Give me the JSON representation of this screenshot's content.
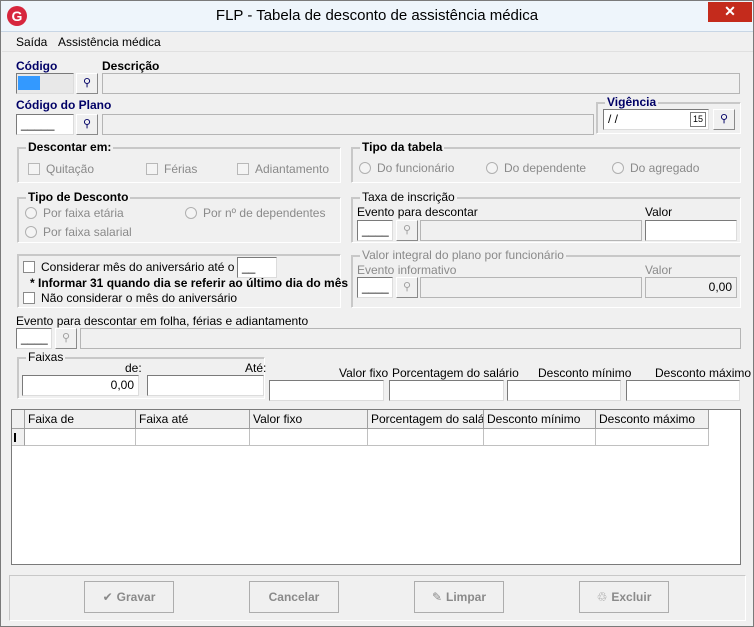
{
  "window": {
    "title": "FLP - Tabela de desconto de assistência médica",
    "app_icon": "G",
    "close": "✕"
  },
  "menu": {
    "saida": "Saída",
    "assistencia": "Assistência médica"
  },
  "codigo": {
    "label": "Código",
    "value": ""
  },
  "descricao": {
    "label": "Descrição",
    "value": ""
  },
  "codigo_plano": {
    "label": "Código do Plano",
    "value": "_____"
  },
  "vigencia": {
    "label": "Vigência",
    "value": "/ /",
    "calendar": "15"
  },
  "descontar_em": {
    "title": "Descontar em:",
    "options": [
      "Quitação",
      "Férias",
      "Adiantamento"
    ]
  },
  "tipo_tabela": {
    "title": "Tipo da tabela",
    "options": [
      "Do funcionário",
      "Do dependente",
      "Do agregado"
    ]
  },
  "tipo_desconto": {
    "title": "Tipo de Desconto",
    "options": [
      "Por faixa etária",
      "Por nº de dependentes",
      "Por faixa salarial"
    ]
  },
  "taxa_inscricao": {
    "title": "Taxa de inscrição",
    "evento_label": "Evento para descontar",
    "valor_label": "Valor",
    "evento_value": "____"
  },
  "aniversario": {
    "considerar_label": "Considerar mês do aniversário até o dia",
    "dia_value": "__",
    "note": "* Informar 31 quando dia se referir ao último dia do mês",
    "nao_considerar_label": "Não considerar o mês do aniversário"
  },
  "valor_integral": {
    "title": "Valor integral do plano por funcionário",
    "evento_label": "Evento informativo",
    "valor_label": "Valor",
    "evento_value": "____",
    "valor_value": "0,00"
  },
  "evento_folha": {
    "label": "Evento para descontar em folha, férias e adiantamento",
    "value": "____"
  },
  "faixas": {
    "title": "Faixas",
    "de_label": "de:",
    "ate_label": "Até:",
    "de_value": "0,00",
    "ate_value": ""
  },
  "valor_fixo_label": "Valor fixo",
  "porcentagem_label": "Porcentagem do salário",
  "desconto_minimo_label": "Desconto mínimo",
  "desconto_maximo_label": "Desconto máximo",
  "grid": {
    "columns": [
      "Faixa de",
      "Faixa até",
      "Valor fixo",
      "Porcentagem do salário",
      "Desconto mínimo",
      "Desconto máximo"
    ]
  },
  "buttons": {
    "gravar": "Gravar",
    "cancelar": "Cancelar",
    "limpar": "Limpar",
    "excluir": "Excluir"
  },
  "icons": {
    "binoculars": "🔭",
    "check": "✔",
    "broom": "🧹",
    "trash": "🗑"
  }
}
